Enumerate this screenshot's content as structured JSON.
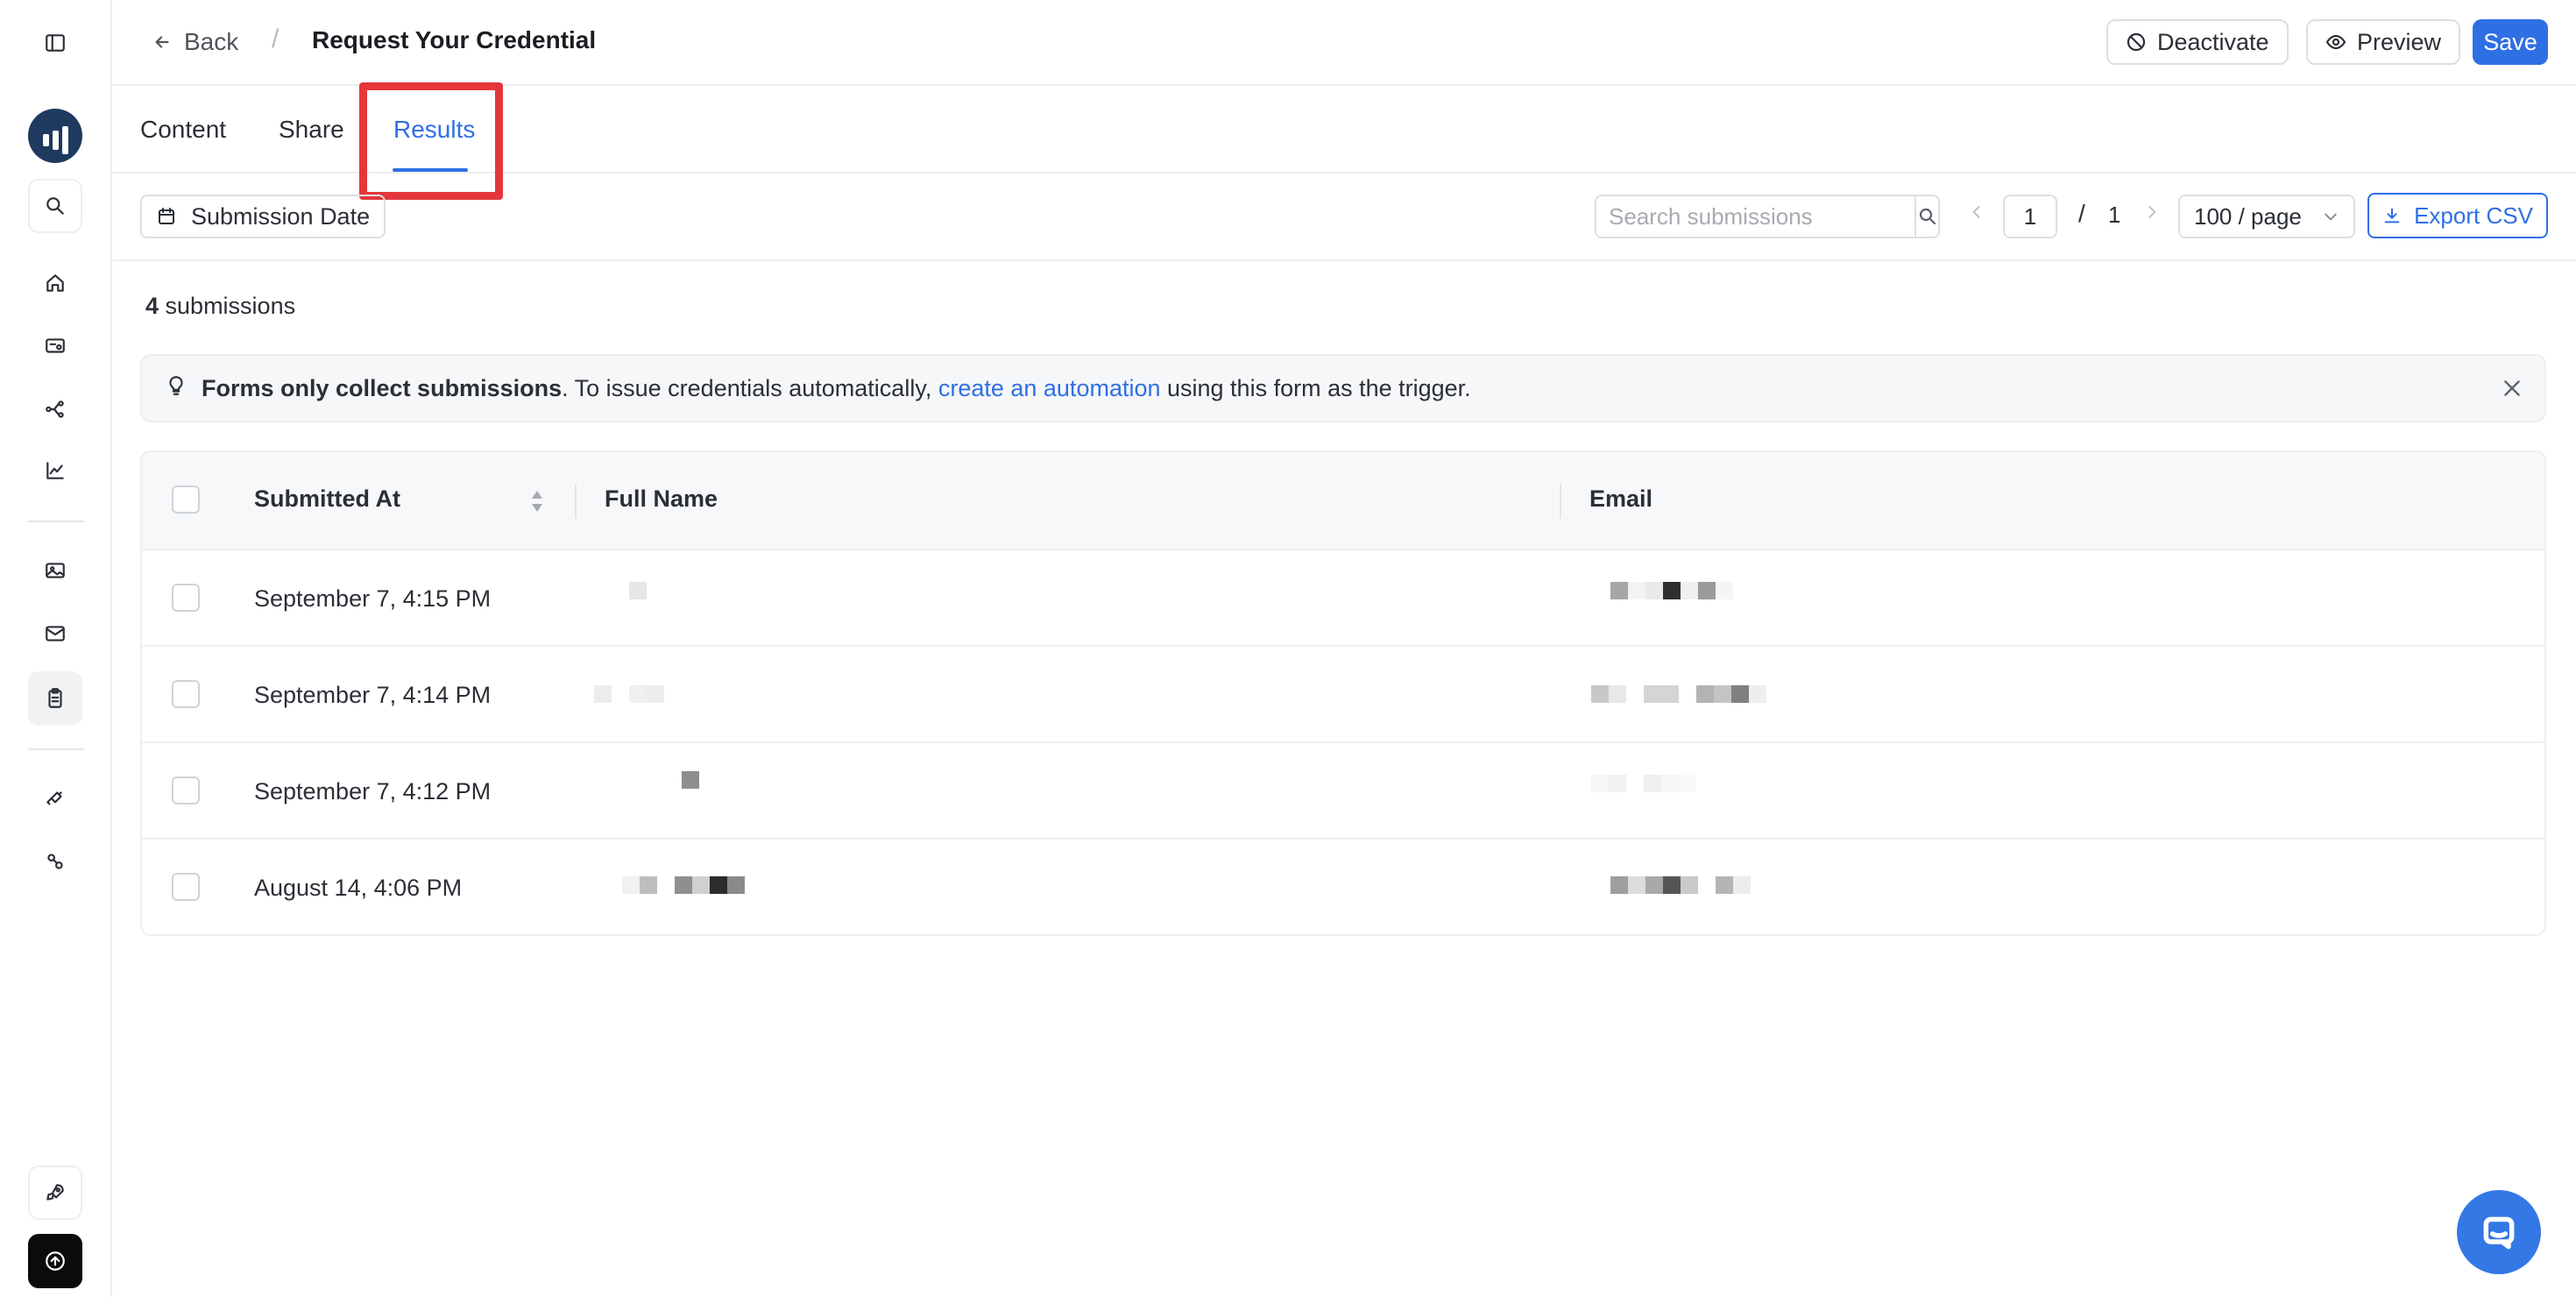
{
  "header": {
    "back_label": "Back",
    "separator": "/",
    "title": "Request Your Credential",
    "deactivate_label": "Deactivate",
    "preview_label": "Preview",
    "save_label": "Save"
  },
  "tabs": [
    {
      "label": "Content",
      "active": false
    },
    {
      "label": "Share",
      "active": false
    },
    {
      "label": "Results",
      "active": true
    }
  ],
  "toolbar": {
    "date_filter_label": "Submission Date",
    "search_placeholder": "Search submissions",
    "page_current": "1",
    "page_separator": "/",
    "page_total": "1",
    "per_page": "100 / page",
    "export_label": "Export CSV"
  },
  "summary": {
    "count": "4",
    "count_suffix": " submissions"
  },
  "notice": {
    "bold_text": "Forms only collect submissions",
    "text_before_link": ". To issue credentials automatically, ",
    "link_text": "create an automation",
    "text_after_link": " using this form as the trigger."
  },
  "table": {
    "columns": [
      "Submitted At",
      "Full Name",
      "Email"
    ],
    "rows": [
      {
        "submitted_at": "September 7, 4:15 PM"
      },
      {
        "submitted_at": "September 7, 4:14 PM"
      },
      {
        "submitted_at": "September 7, 4:12 PM"
      },
      {
        "submitted_at": "August 14, 4:06 PM"
      }
    ]
  },
  "colors": {
    "accent": "#2f6fe4",
    "highlight": "#e5373b",
    "logo_bg": "#1e3a5f",
    "chat_bg": "#3478e6"
  },
  "icons": {
    "rail": [
      "sidebar-toggle-icon",
      "app-logo",
      "search-icon",
      "home-icon",
      "credential-icon",
      "workflow-icon",
      "analytics-icon",
      "image-icon",
      "mail-icon",
      "clipboard-icon",
      "integration-icon",
      "link-icon",
      "rocket-icon",
      "upload-icon"
    ],
    "chat": "chat-icon"
  }
}
